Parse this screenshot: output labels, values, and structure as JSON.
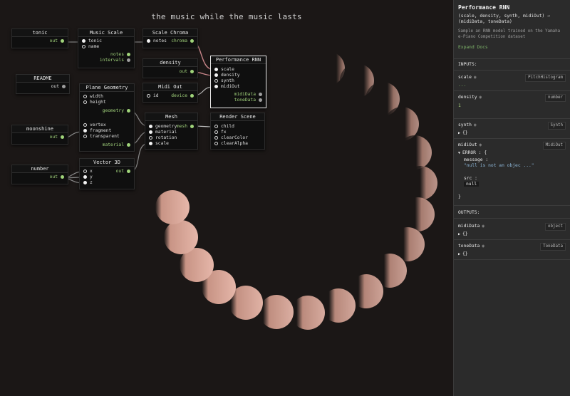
{
  "canvas": {
    "title": "the music while the music lasts"
  },
  "nodes": {
    "tonic": {
      "title": "tonic",
      "out": "out"
    },
    "readme": {
      "title": "README",
      "out": "out"
    },
    "moonshine": {
      "title": "moonshine",
      "out": "out"
    },
    "number": {
      "title": "number",
      "out": "out"
    },
    "music_scale": {
      "title": "Music Scale",
      "in1": "tonic",
      "in2": "name",
      "out1": "notes",
      "out2": "intervals"
    },
    "plane_geometry": {
      "title": "Plane Geometry",
      "in1": "width",
      "in2": "height",
      "out1": "geometry",
      "in3": "vertex",
      "in4": "fragment",
      "in5": "transparent",
      "out2": "material"
    },
    "vector3d": {
      "title": "Vector 3D",
      "in1": "x",
      "in2": "y",
      "in3": "z",
      "out": "out"
    },
    "scale_chroma": {
      "title": "Scale Chroma",
      "in1": "notes",
      "out": "chroma"
    },
    "density": {
      "title": "density",
      "out": "out"
    },
    "midi_out": {
      "title": "Midi Out",
      "in1": "id",
      "out": "device"
    },
    "mesh": {
      "title": "Mesh",
      "in1": "geometry",
      "in2": "material",
      "in3": "rotation",
      "in4": "scale",
      "out": "mesh"
    },
    "performance_rnn": {
      "title": "Performance RNN",
      "in1": "scale",
      "in2": "density",
      "in3": "synth",
      "in4": "midiOut",
      "out1": "midiData",
      "out2": "toneData"
    },
    "render_scene": {
      "title": "Render Scene",
      "in1": "child",
      "in2": "fx",
      "in3": "clearColor",
      "in4": "clearAlpha"
    }
  },
  "panel": {
    "title": "Performance RNN",
    "signature": "(scale, density, synth, midiOut) → (midiData, toneData)",
    "description": "Sample an RNN model trained on the Yamaha e-Piano Competition dataset",
    "expand_docs": "Expand Docs",
    "inputs_heading": "INPUTS:",
    "outputs_heading": "OUTPUTS:",
    "inputs": [
      {
        "name": "scale",
        "type": "PitchHistogram",
        "value": "..."
      },
      {
        "name": "density",
        "type": "number",
        "value": "1"
      },
      {
        "name": "synth",
        "type": "Synth",
        "value": "{}"
      },
      {
        "name": "midiOut",
        "type": "MidiOut",
        "value": ""
      }
    ],
    "error": {
      "label": "ERROR :",
      "open_brace": "{",
      "message_key": "message :",
      "message_value": "\"null is not an objec ...\"",
      "src_key": "src :",
      "src_value": "null",
      "close_brace": "}"
    },
    "outputs": [
      {
        "name": "midiData",
        "type": "object",
        "value": "{}"
      },
      {
        "name": "toneData",
        "type": "ToneData",
        "value": "{}"
      }
    ]
  },
  "colors": {
    "background": "#1b1716",
    "panel": "#2b2b2b",
    "accent_green": "#9fd07a",
    "wire_pink": "#c9868a",
    "moon": "#e3b0a6"
  }
}
